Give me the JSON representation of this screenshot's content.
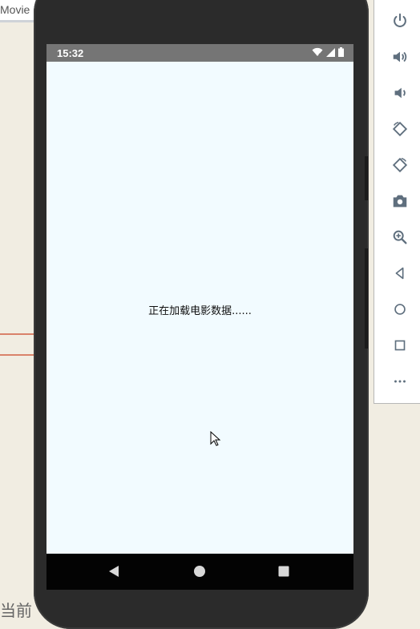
{
  "background_app": {
    "tab_label": "Movie",
    "bottom_text": "当前"
  },
  "device": {
    "status_bar": {
      "time": "15:32",
      "icons": [
        "wifi-icon",
        "signal-icon",
        "battery-icon"
      ]
    },
    "content": {
      "loading_message": "正在加载电影数据......"
    },
    "nav_bar": {
      "buttons": [
        "back",
        "home",
        "recents"
      ]
    }
  },
  "emulator_toolbar": {
    "tools": [
      "power",
      "volume-up",
      "volume-down",
      "rotate-left",
      "rotate-right",
      "screenshot",
      "zoom",
      "back",
      "home",
      "overview",
      "more"
    ]
  },
  "colors": {
    "status_bar": "#757575",
    "screen_bg": "#f2fbff",
    "nav_bar": "#030303",
    "toolbar_icon": "#5f6f7e"
  }
}
